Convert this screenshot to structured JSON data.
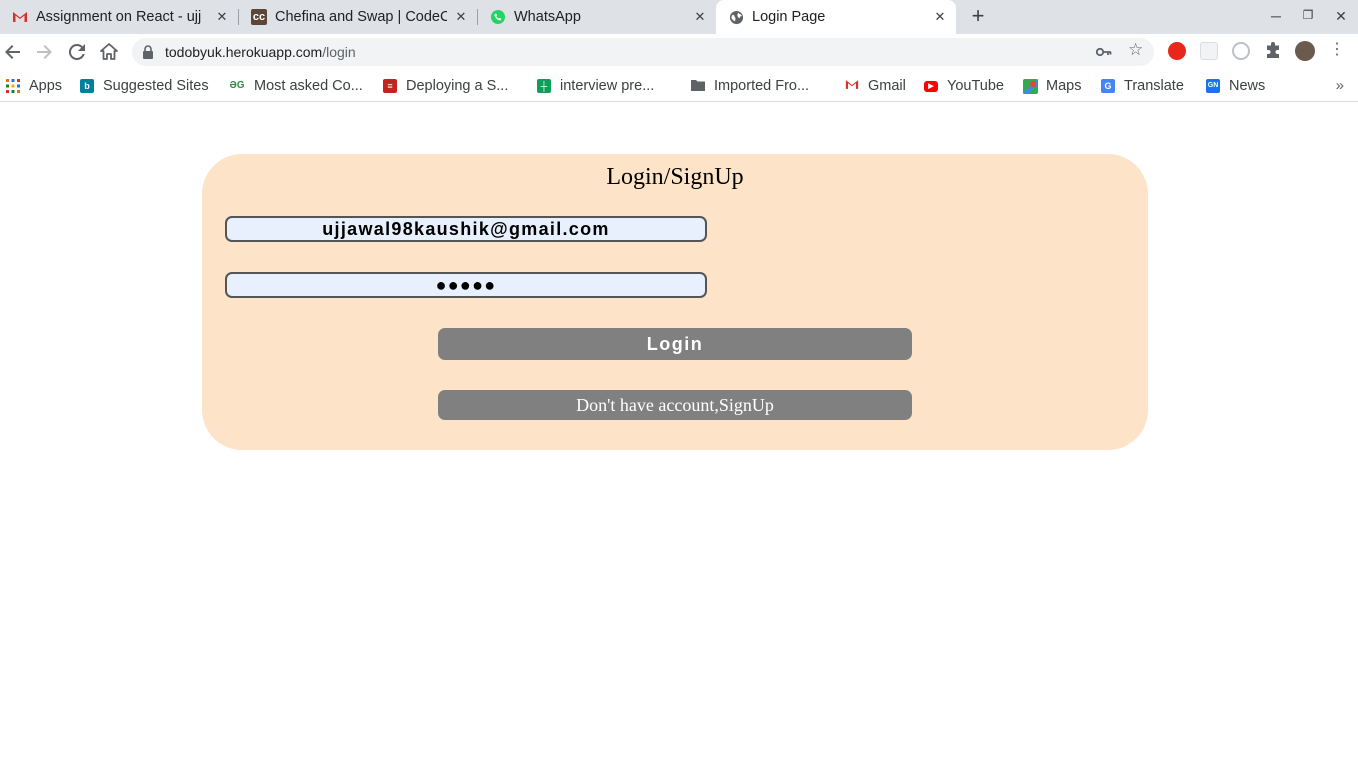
{
  "browser": {
    "tabs": [
      {
        "title": "Assignment on React - ujj",
        "icon": "gmail-icon"
      },
      {
        "title": "Chefina and Swap | CodeC",
        "icon": "codechef-icon"
      },
      {
        "title": "WhatsApp",
        "icon": "whatsapp-icon"
      },
      {
        "title": "Login Page",
        "icon": "globe-icon",
        "active": true
      }
    ],
    "address": {
      "host": "todobyuk.herokuapp.com",
      "path": "/login"
    },
    "bookmarks": [
      {
        "label": "Apps",
        "icon": "apps-grid-icon"
      },
      {
        "label": "Suggested Sites",
        "icon": "bing-icon"
      },
      {
        "label": "Most asked Co...",
        "icon": "geeksforgeeks-icon"
      },
      {
        "label": "Deploying a S...",
        "icon": "bookmark-red-icon"
      },
      {
        "label": "interview pre...",
        "icon": "sheets-icon"
      },
      {
        "label": "Imported Fro...",
        "icon": "folder-icon"
      },
      {
        "label": "Gmail",
        "icon": "gmail-icon"
      },
      {
        "label": "YouTube",
        "icon": "youtube-icon"
      },
      {
        "label": "Maps",
        "icon": "maps-icon"
      },
      {
        "label": "Translate",
        "icon": "translate-icon"
      },
      {
        "label": "News",
        "icon": "news-icon"
      }
    ],
    "bookmarks_more": "»"
  },
  "page": {
    "title": "Login/SignUp",
    "email_value": "ujjawal98kaushik@gmail.com",
    "password_value": "●●●●●",
    "login_label": "Login",
    "signup_label": "Don't have account,SignUp"
  },
  "colors": {
    "card_background": "#fde3c7",
    "input_background": "#e8f0fe",
    "button_background": "#808080"
  }
}
